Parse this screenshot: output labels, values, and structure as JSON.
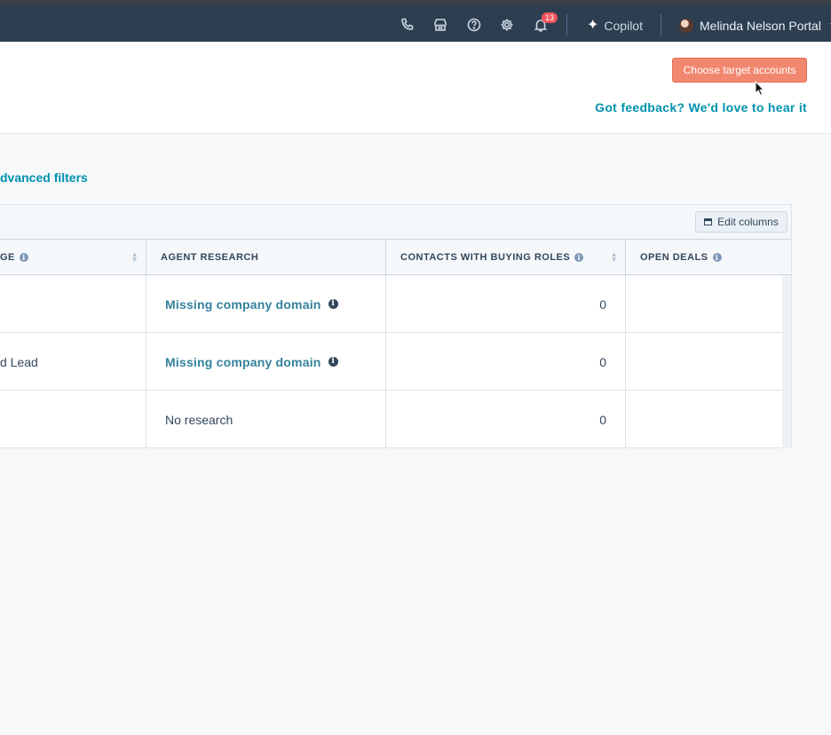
{
  "topnav": {
    "icons": [
      "phone-icon",
      "marketplace-icon",
      "help-icon",
      "settings-icon",
      "notifications-icon"
    ],
    "notification_count": "13",
    "copilot_label": "Copilot",
    "user_name": "Melinda Nelson Portal"
  },
  "header": {
    "choose_target_label": "Choose target accounts",
    "feedback_label": "Got feedback? We'd love to hear it"
  },
  "filters": {
    "advanced_label": "dvanced filters"
  },
  "table": {
    "edit_columns_label": "Edit columns",
    "columns": [
      {
        "label": "GE"
      },
      {
        "label": "AGENT RESEARCH"
      },
      {
        "label": "CONTACTS WITH BUYING ROLES"
      },
      {
        "label": "OPEN DEALS"
      }
    ],
    "rows": [
      {
        "stage": "",
        "research": "Missing company domain",
        "research_missing": true,
        "contacts": "0",
        "deals": ""
      },
      {
        "stage": "d Lead",
        "research": "Missing company domain",
        "research_missing": true,
        "contacts": "0",
        "deals": ""
      },
      {
        "stage": "",
        "research": "No research",
        "research_missing": false,
        "contacts": "0",
        "deals": ""
      }
    ]
  },
  "colors": {
    "nav_bg": "#2d3e50",
    "primary_button": "#f2876f",
    "link": "#0091ae"
  }
}
